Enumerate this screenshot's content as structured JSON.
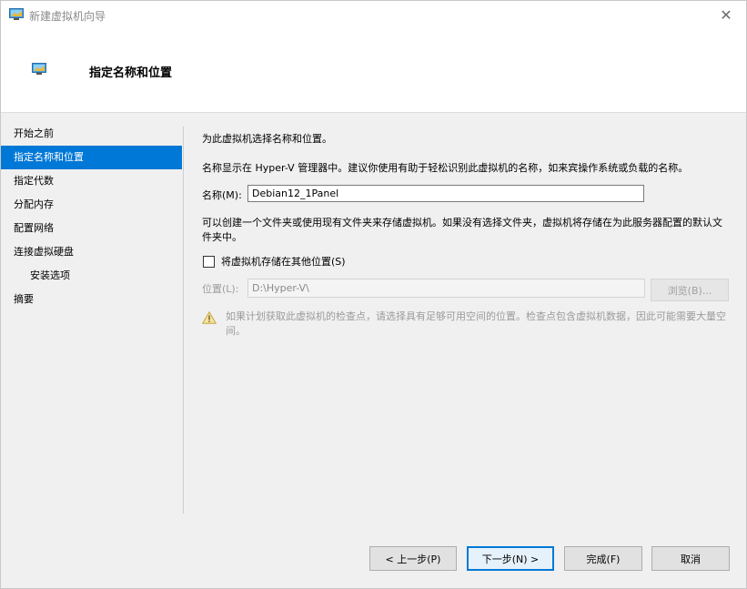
{
  "window": {
    "title": "新建虚拟机向导",
    "close_glyph": "✕"
  },
  "header": {
    "title": "指定名称和位置",
    "icon": "vm-monitor-icon"
  },
  "nav": {
    "items": [
      {
        "label": "开始之前"
      },
      {
        "label": "指定名称和位置"
      },
      {
        "label": "指定代数"
      },
      {
        "label": "分配内存"
      },
      {
        "label": "配置网络"
      },
      {
        "label": "连接虚拟硬盘"
      },
      {
        "label": "安装选项"
      },
      {
        "label": "摘要"
      }
    ],
    "active_index": 1,
    "accent": "#0078d7"
  },
  "main": {
    "intro": "为此虚拟机选择名称和位置。",
    "name_description": "名称显示在 Hyper-V 管理器中。建议你使用有助于轻松识别此虚拟机的名称，如来宾操作系统或负载的名称。",
    "name_label": "名称(M):",
    "name_value": "Debian12_1Panel",
    "folder_description": "可以创建一个文件夹或使用现有文件夹来存储虚拟机。如果没有选择文件夹，虚拟机将存储在为此服务器配置的默认文件夹中。",
    "store_elsewhere_label": "将虚拟机存储在其他位置(S)",
    "store_elsewhere_checked": false,
    "location_label": "位置(L):",
    "location_value": "D:\\Hyper-V\\",
    "browse_label": "浏览(B)...",
    "warning": "如果计划获取此虚拟机的检查点，请选择具有足够可用空间的位置。检查点包含虚拟机数据，因此可能需要大量空间。"
  },
  "footer": {
    "prev_label": "< 上一步(P)",
    "next_label": "下一步(N) >",
    "finish_label": "完成(F)",
    "cancel_label": "取消"
  }
}
